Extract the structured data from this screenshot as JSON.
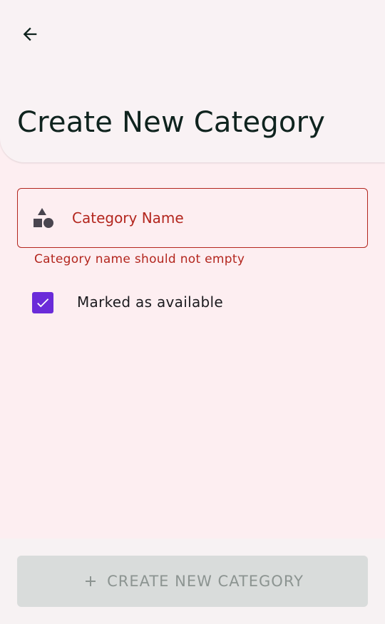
{
  "header": {
    "back_icon": "arrow-back-icon",
    "title": "Create New Category"
  },
  "form": {
    "category_name": {
      "icon": "category-shapes-icon",
      "placeholder": "Category Name",
      "value": "",
      "error": "Category name should not empty"
    },
    "available": {
      "label": "Marked as available",
      "checked": true
    }
  },
  "footer": {
    "create_button_icon": "plus-icon",
    "create_button_label": "CREATE NEW CATEGORY"
  },
  "colors": {
    "error": "#b3261e",
    "accent": "#6a2bd9",
    "background": "#fdeef1",
    "app_bar": "#f9f2f4",
    "disabled_button": "#d9dcdb"
  }
}
